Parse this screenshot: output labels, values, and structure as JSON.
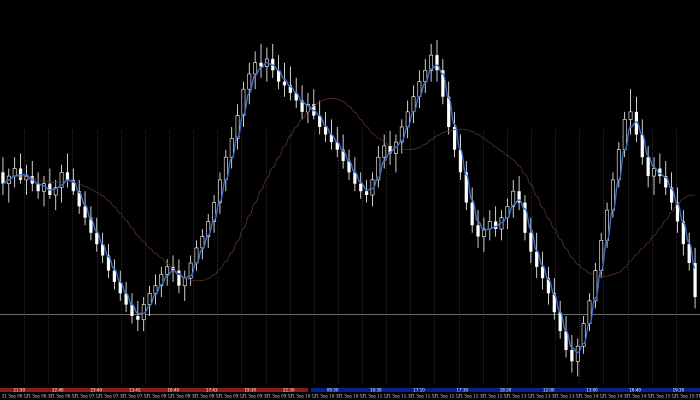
{
  "chart_data": {
    "type": "candlestick",
    "grid": false,
    "legend": "none",
    "background_color": "#000000",
    "candle_color": "#ffffff",
    "vertical_separator_color": "#4a4a4a",
    "horizontal_line_color": "#7a7a7a",
    "series": [
      {
        "kind": "smooth_fast_ma",
        "color": "#3b6fc4"
      },
      {
        "kind": "slow_ma",
        "color": "#5a2f2f"
      }
    ],
    "ylim": [
      0,
      100
    ],
    "price_line": 18.5,
    "session_bars": {
      "left_color": "#8b1a1a",
      "right_color": "#0a1f8f",
      "left_labels": [
        "21:50",
        "22:40",
        "23:40",
        "13:42",
        "16:40",
        "17:43",
        "19:30",
        "22:30"
      ],
      "right_labels": [
        "09:30",
        "10:30",
        "17:10",
        "17:30",
        "18:30",
        "12:00",
        "13:00",
        "16:40",
        "19:30"
      ]
    },
    "x_tick_labels": [
      "21 Sep 06:17",
      "21 Sep 06:37",
      "21 Sep 06:57",
      "21 Sep 07:17",
      "21 Sep 07:37",
      "21 Sep 07:57",
      "21 Sep 08:17",
      "21 Sep 08:37",
      "21 Sep 08:57",
      "21 Sep 09:17",
      "21 Sep 09:37",
      "21 Sep 09:57",
      "21 Sep 10:17",
      "21 Sep 10:37",
      "21 Sep 10:57",
      "21 Sep 11:17",
      "21 Sep 11:37",
      "21 Sep 11:57",
      "21 Sep 12:17",
      "21 Sep 12:37",
      "21 Sep 12:57",
      "21 Sep 13:17",
      "21 Sep 13:37",
      "21 Sep 13:57",
      "21 Sep 14:17",
      "21 Sep 14:37",
      "21 Sep 14:57",
      "21 Sep 15:17",
      "21 Sep 15:37"
    ],
    "candles": [
      {
        "o": 56,
        "h": 60,
        "l": 50,
        "c": 53
      },
      {
        "o": 53,
        "h": 57,
        "l": 48,
        "c": 55
      },
      {
        "o": 55,
        "h": 60,
        "l": 52,
        "c": 57
      },
      {
        "o": 57,
        "h": 61,
        "l": 53,
        "c": 54
      },
      {
        "o": 54,
        "h": 58,
        "l": 50,
        "c": 55
      },
      {
        "o": 55,
        "h": 59,
        "l": 51,
        "c": 53
      },
      {
        "o": 53,
        "h": 56,
        "l": 49,
        "c": 51
      },
      {
        "o": 51,
        "h": 55,
        "l": 47,
        "c": 53
      },
      {
        "o": 53,
        "h": 57,
        "l": 49,
        "c": 50
      },
      {
        "o": 50,
        "h": 54,
        "l": 46,
        "c": 52
      },
      {
        "o": 52,
        "h": 58,
        "l": 48,
        "c": 56
      },
      {
        "o": 56,
        "h": 61,
        "l": 52,
        "c": 54
      },
      {
        "o": 54,
        "h": 57,
        "l": 50,
        "c": 51
      },
      {
        "o": 51,
        "h": 54,
        "l": 45,
        "c": 47
      },
      {
        "o": 47,
        "h": 51,
        "l": 42,
        "c": 44
      },
      {
        "o": 44,
        "h": 47,
        "l": 38,
        "c": 40
      },
      {
        "o": 40,
        "h": 44,
        "l": 35,
        "c": 37
      },
      {
        "o": 37,
        "h": 40,
        "l": 32,
        "c": 34
      },
      {
        "o": 34,
        "h": 37,
        "l": 28,
        "c": 30
      },
      {
        "o": 30,
        "h": 33,
        "l": 25,
        "c": 27
      },
      {
        "o": 27,
        "h": 30,
        "l": 22,
        "c": 24
      },
      {
        "o": 24,
        "h": 27,
        "l": 19,
        "c": 21
      },
      {
        "o": 21,
        "h": 24,
        "l": 16,
        "c": 18
      },
      {
        "o": 18,
        "h": 22,
        "l": 14,
        "c": 17
      },
      {
        "o": 17,
        "h": 23,
        "l": 14,
        "c": 21
      },
      {
        "o": 21,
        "h": 26,
        "l": 18,
        "c": 24
      },
      {
        "o": 24,
        "h": 29,
        "l": 21,
        "c": 26
      },
      {
        "o": 26,
        "h": 31,
        "l": 23,
        "c": 29
      },
      {
        "o": 29,
        "h": 33,
        "l": 26,
        "c": 31
      },
      {
        "o": 31,
        "h": 34,
        "l": 27,
        "c": 30
      },
      {
        "o": 30,
        "h": 33,
        "l": 24,
        "c": 26
      },
      {
        "o": 26,
        "h": 30,
        "l": 22,
        "c": 28
      },
      {
        "o": 28,
        "h": 34,
        "l": 26,
        "c": 32
      },
      {
        "o": 32,
        "h": 38,
        "l": 30,
        "c": 36
      },
      {
        "o": 36,
        "h": 41,
        "l": 33,
        "c": 39
      },
      {
        "o": 39,
        "h": 45,
        "l": 36,
        "c": 43
      },
      {
        "o": 43,
        "h": 50,
        "l": 40,
        "c": 48
      },
      {
        "o": 48,
        "h": 56,
        "l": 45,
        "c": 54
      },
      {
        "o": 54,
        "h": 62,
        "l": 51,
        "c": 60
      },
      {
        "o": 60,
        "h": 68,
        "l": 57,
        "c": 65
      },
      {
        "o": 65,
        "h": 74,
        "l": 62,
        "c": 71
      },
      {
        "o": 71,
        "h": 80,
        "l": 68,
        "c": 78
      },
      {
        "o": 78,
        "h": 85,
        "l": 74,
        "c": 82
      },
      {
        "o": 82,
        "h": 88,
        "l": 78,
        "c": 85
      },
      {
        "o": 85,
        "h": 90,
        "l": 81,
        "c": 84
      },
      {
        "o": 84,
        "h": 89,
        "l": 80,
        "c": 86
      },
      {
        "o": 86,
        "h": 90,
        "l": 81,
        "c": 83
      },
      {
        "o": 83,
        "h": 87,
        "l": 78,
        "c": 80
      },
      {
        "o": 80,
        "h": 85,
        "l": 76,
        "c": 79
      },
      {
        "o": 79,
        "h": 84,
        "l": 75,
        "c": 77
      },
      {
        "o": 77,
        "h": 81,
        "l": 73,
        "c": 75
      },
      {
        "o": 75,
        "h": 79,
        "l": 70,
        "c": 72
      },
      {
        "o": 72,
        "h": 77,
        "l": 69,
        "c": 74
      },
      {
        "o": 74,
        "h": 78,
        "l": 70,
        "c": 71
      },
      {
        "o": 71,
        "h": 75,
        "l": 66,
        "c": 68
      },
      {
        "o": 68,
        "h": 72,
        "l": 64,
        "c": 66
      },
      {
        "o": 66,
        "h": 70,
        "l": 62,
        "c": 64
      },
      {
        "o": 64,
        "h": 68,
        "l": 60,
        "c": 62
      },
      {
        "o": 62,
        "h": 66,
        "l": 57,
        "c": 59
      },
      {
        "o": 59,
        "h": 62,
        "l": 54,
        "c": 56
      },
      {
        "o": 56,
        "h": 60,
        "l": 51,
        "c": 53
      },
      {
        "o": 53,
        "h": 56,
        "l": 49,
        "c": 51
      },
      {
        "o": 51,
        "h": 54,
        "l": 48,
        "c": 50
      },
      {
        "o": 50,
        "h": 56,
        "l": 47,
        "c": 54
      },
      {
        "o": 54,
        "h": 63,
        "l": 52,
        "c": 60
      },
      {
        "o": 60,
        "h": 66,
        "l": 57,
        "c": 63
      },
      {
        "o": 63,
        "h": 67,
        "l": 58,
        "c": 61
      },
      {
        "o": 61,
        "h": 66,
        "l": 56,
        "c": 64
      },
      {
        "o": 64,
        "h": 70,
        "l": 61,
        "c": 68
      },
      {
        "o": 68,
        "h": 75,
        "l": 65,
        "c": 72
      },
      {
        "o": 72,
        "h": 79,
        "l": 69,
        "c": 76
      },
      {
        "o": 76,
        "h": 83,
        "l": 73,
        "c": 80
      },
      {
        "o": 80,
        "h": 86,
        "l": 77,
        "c": 83
      },
      {
        "o": 83,
        "h": 90,
        "l": 80,
        "c": 87
      },
      {
        "o": 87,
        "h": 91,
        "l": 80,
        "c": 83
      },
      {
        "o": 83,
        "h": 86,
        "l": 74,
        "c": 76
      },
      {
        "o": 76,
        "h": 80,
        "l": 66,
        "c": 68
      },
      {
        "o": 68,
        "h": 72,
        "l": 60,
        "c": 62
      },
      {
        "o": 62,
        "h": 66,
        "l": 54,
        "c": 56
      },
      {
        "o": 56,
        "h": 59,
        "l": 46,
        "c": 48
      },
      {
        "o": 48,
        "h": 52,
        "l": 40,
        "c": 42
      },
      {
        "o": 42,
        "h": 46,
        "l": 36,
        "c": 39
      },
      {
        "o": 39,
        "h": 44,
        "l": 35,
        "c": 41
      },
      {
        "o": 41,
        "h": 46,
        "l": 38,
        "c": 43
      },
      {
        "o": 43,
        "h": 47,
        "l": 39,
        "c": 41
      },
      {
        "o": 41,
        "h": 46,
        "l": 38,
        "c": 44
      },
      {
        "o": 44,
        "h": 49,
        "l": 41,
        "c": 47
      },
      {
        "o": 47,
        "h": 54,
        "l": 44,
        "c": 51
      },
      {
        "o": 51,
        "h": 55,
        "l": 46,
        "c": 48
      },
      {
        "o": 48,
        "h": 50,
        "l": 38,
        "c": 40
      },
      {
        "o": 40,
        "h": 44,
        "l": 32,
        "c": 35
      },
      {
        "o": 35,
        "h": 40,
        "l": 28,
        "c": 31
      },
      {
        "o": 31,
        "h": 35,
        "l": 25,
        "c": 28
      },
      {
        "o": 28,
        "h": 31,
        "l": 21,
        "c": 24
      },
      {
        "o": 24,
        "h": 28,
        "l": 17,
        "c": 19
      },
      {
        "o": 19,
        "h": 22,
        "l": 12,
        "c": 14
      },
      {
        "o": 14,
        "h": 18,
        "l": 7,
        "c": 9
      },
      {
        "o": 9,
        "h": 13,
        "l": 3,
        "c": 6
      },
      {
        "o": 6,
        "h": 12,
        "l": 2,
        "c": 10
      },
      {
        "o": 10,
        "h": 18,
        "l": 8,
        "c": 16
      },
      {
        "o": 16,
        "h": 24,
        "l": 14,
        "c": 22
      },
      {
        "o": 22,
        "h": 32,
        "l": 20,
        "c": 30
      },
      {
        "o": 30,
        "h": 40,
        "l": 28,
        "c": 38
      },
      {
        "o": 38,
        "h": 48,
        "l": 36,
        "c": 46
      },
      {
        "o": 46,
        "h": 56,
        "l": 44,
        "c": 54
      },
      {
        "o": 54,
        "h": 64,
        "l": 52,
        "c": 62
      },
      {
        "o": 62,
        "h": 72,
        "l": 60,
        "c": 70
      },
      {
        "o": 70,
        "h": 78,
        "l": 66,
        "c": 72
      },
      {
        "o": 72,
        "h": 76,
        "l": 64,
        "c": 66
      },
      {
        "o": 66,
        "h": 70,
        "l": 58,
        "c": 60
      },
      {
        "o": 60,
        "h": 63,
        "l": 52,
        "c": 55
      },
      {
        "o": 55,
        "h": 60,
        "l": 50,
        "c": 57
      },
      {
        "o": 57,
        "h": 61,
        "l": 53,
        "c": 55
      },
      {
        "o": 55,
        "h": 59,
        "l": 50,
        "c": 52
      },
      {
        "o": 52,
        "h": 56,
        "l": 46,
        "c": 48
      },
      {
        "o": 48,
        "h": 52,
        "l": 40,
        "c": 43
      },
      {
        "o": 43,
        "h": 46,
        "l": 34,
        "c": 37
      },
      {
        "o": 37,
        "h": 40,
        "l": 30,
        "c": 32
      },
      {
        "o": 32,
        "h": 36,
        "l": 20,
        "c": 23
      }
    ]
  }
}
